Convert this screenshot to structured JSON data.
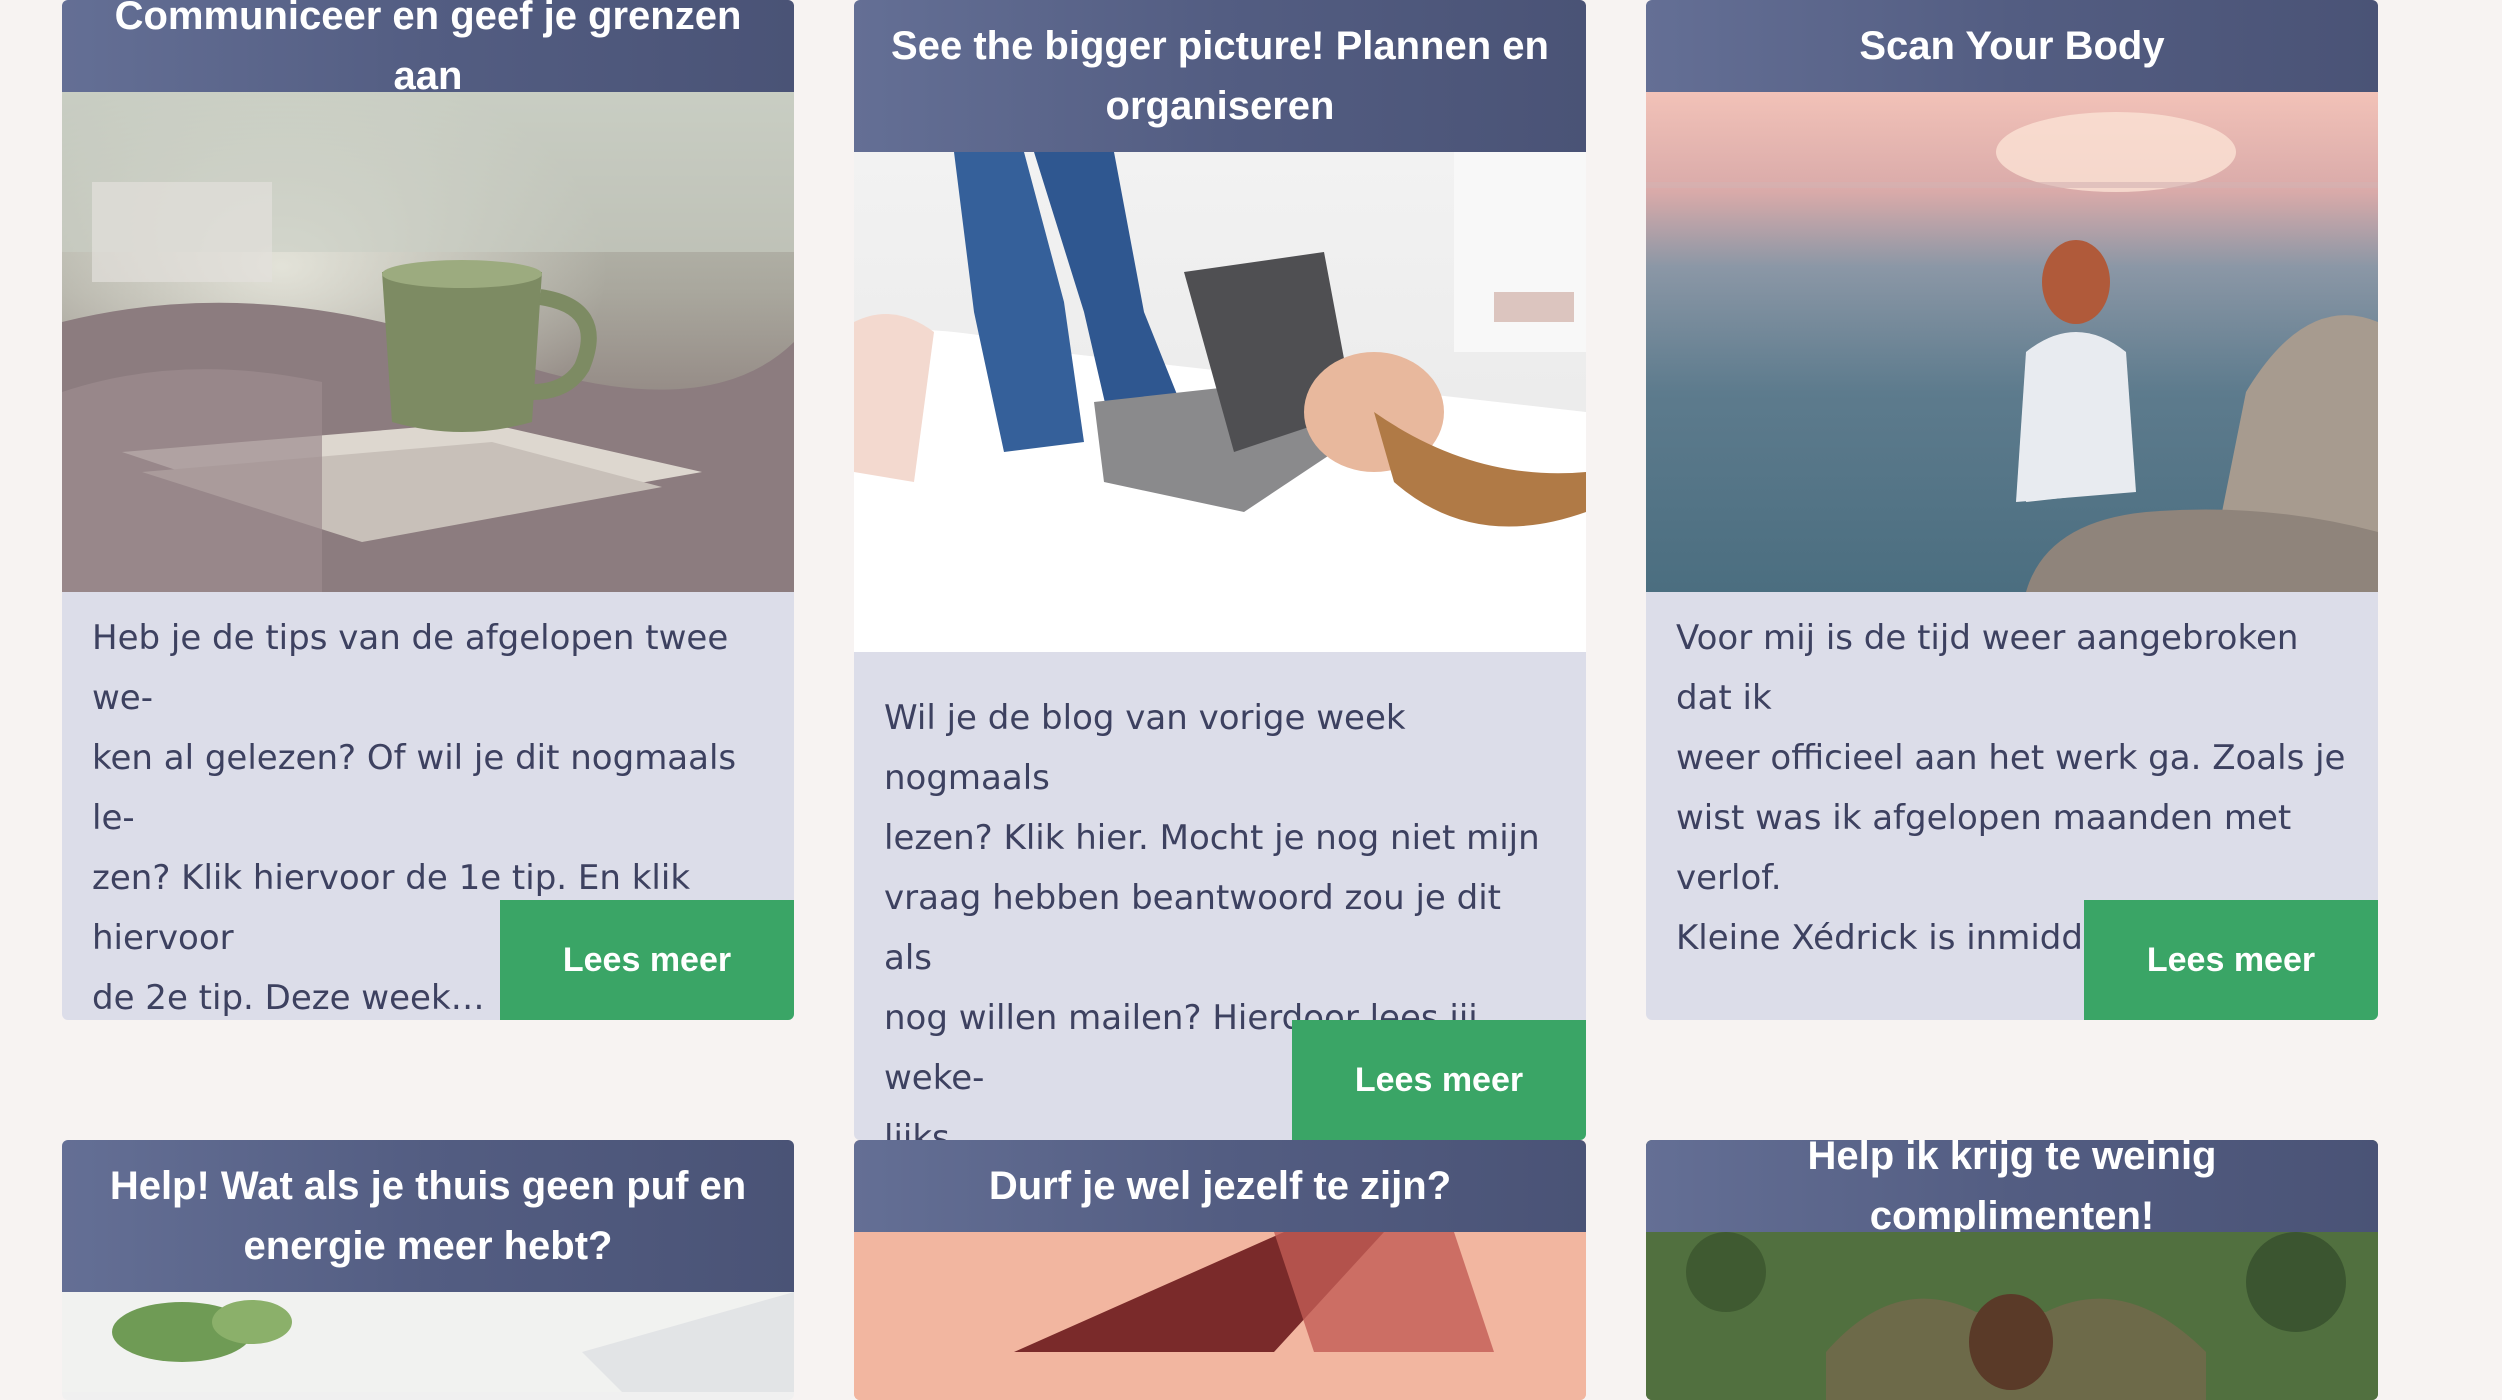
{
  "cards": [
    {
      "title": "Communiceer en geef je grenzen aan",
      "image_alt": "Kop koffie op een opengeslagen boek bij het raam",
      "text": "Heb je de tips van de afgelopen twee we-ken al gelezen? Of wil je dit nogmaals le-zen? Klik hiervoor de 1e tip. En klik hiervoor de 2e tip. Deze week…",
      "text_lines": [
        "Heb je de tips van de afgelopen twee we-",
        "ken al gelezen? Of wil je dit nogmaals le-",
        "zen? Klik hiervoor de 1e tip. En klik hiervoor",
        "de 2e tip. Deze week…"
      ],
      "button": "Lees meer"
    },
    {
      "title": "See the bigger picture! Plannen en organiseren",
      "image_alt": "Vrouw ligt op bed met een boek op haar gezicht",
      "text_lines": [
        "Wil je de blog van vorige week nogmaals",
        "lezen? Klik hier. Mocht je nog niet mijn",
        "vraag hebben beantwoord zou je dit als",
        "nog willen mailen? Hierdoor lees jij weke-",
        "lijks…"
      ],
      "button": "Lees meer"
    },
    {
      "title": "Scan Your Body",
      "image_alt": "Vrouw zit op een rots bij de zee tijdens zonsondergang",
      "text_lines": [
        "Voor mij is de tijd weer aangebroken dat ik",
        "weer officieel aan het werk ga. Zoals je",
        "wist was ik afgelopen maanden met verlof.",
        "Kleine Xédrick is inmiddels al bijna…"
      ],
      "button": "Lees meer"
    },
    {
      "title": "Help! Wat als je thuis geen puf en energie meer hebt?",
      "image_alt": "Plant en toetsenbord"
    },
    {
      "title": "Durf je wel jezelf te zijn?",
      "image_alt": "Roze achtergrond met stoel"
    },
    {
      "title": "Help ik krijg te weinig complimenten!",
      "image_alt": "Man met handen op het hoofd buiten"
    }
  ],
  "colors": {
    "background": "#f7f3f2",
    "card": "#dcdde9",
    "header": "#565f85",
    "button": "#3aa566"
  }
}
